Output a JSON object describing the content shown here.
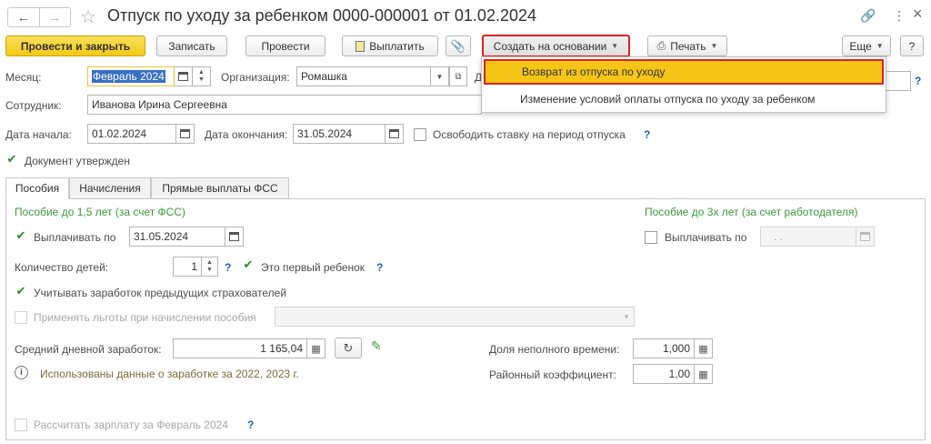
{
  "window": {
    "title": "Отпуск по уходу за ребенком 0000-000001 от 01.02.2024",
    "back_icon": "arrow-left-icon",
    "forward_icon": "arrow-right-icon",
    "favorite_icon": "star-icon",
    "link_icon": "link-icon",
    "more_icon": "vertical-dots",
    "close_label": "×"
  },
  "toolbar": {
    "post_close": "Провести и закрыть",
    "save": "Записать",
    "post": "Провести",
    "pay": "Выплатить",
    "create_based": "Создать на основании",
    "print": "Печать",
    "more": "Еще",
    "help": "?"
  },
  "dropdown": {
    "items": [
      "Возврат из отпуска по уходу",
      "Изменение условий оплаты отпуска по уходу за ребенком"
    ]
  },
  "header": {
    "month_label": "Месяц:",
    "month_value": "Февраль 2024",
    "org_label": "Организация:",
    "org_value": "Ромашка",
    "dept_label_partial": "Д",
    "employee_label": "Сотрудник:",
    "employee_value": "Иванова Ирина Сергеевна",
    "start_label": "Дата начала:",
    "start_value": "01.02.2024",
    "end_label": "Дата окончания:",
    "end_value": "31.05.2024",
    "free_rate_label": "Освободить ставку на период отпуска",
    "approved_label": "Документ утвержден",
    "q": "?"
  },
  "tabs": [
    "Пособия",
    "Начисления",
    "Прямые выплаты ФСС"
  ],
  "benefits": {
    "left_heading": "Пособие до 1,5 лет (за счет ФСС)",
    "right_heading": "Пособие до 3х лет (за счет работодателя)",
    "pay_until_label": "Выплачивать по",
    "pay_until_value": "31.05.2024",
    "pay_until_right_label": "Выплачивать по",
    "pay_until_right_value": ". .",
    "children_label": "Количество детей:",
    "children_value": "1",
    "first_child_label": "Это первый ребенок",
    "prev_insurers_label": "Учитывать заработок предыдущих страхователей",
    "apply_benefits_label": "Применять льготы при начислении пособия",
    "avg_daily_label": "Средний дневной заработок:",
    "avg_daily_value": "1 165,04",
    "part_time_label": "Доля неполного времени:",
    "part_time_value": "1,000",
    "regional_label": "Районный коэффициент:",
    "regional_value": "1,00",
    "info_text": "Использованы данные о заработке за  2022,  2023 г.",
    "calc_salary_label": "Рассчитать зарплату за Февраль 2024"
  },
  "colors": {
    "accent_yellow": "#f2c919",
    "highlight_red": "#e02020",
    "green": "#3a9a3a",
    "link_blue": "#1e5fb3"
  }
}
